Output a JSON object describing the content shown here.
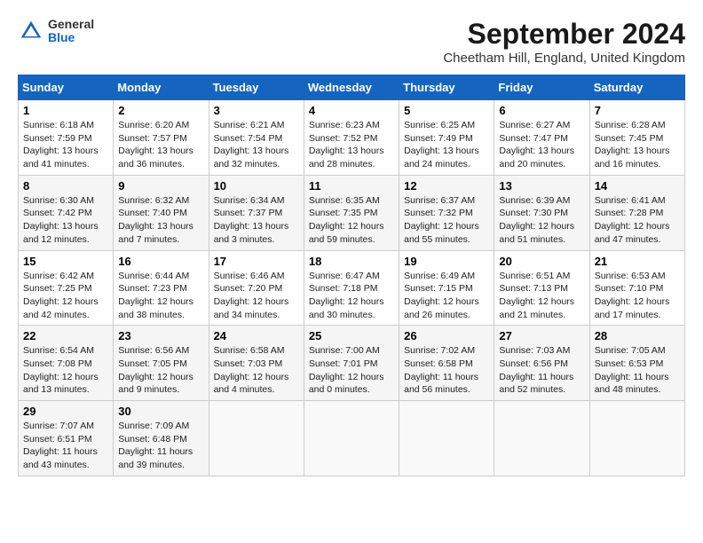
{
  "header": {
    "logo_line1": "General",
    "logo_line2": "Blue",
    "month": "September 2024",
    "location": "Cheetham Hill, England, United Kingdom"
  },
  "days_of_week": [
    "Sunday",
    "Monday",
    "Tuesday",
    "Wednesday",
    "Thursday",
    "Friday",
    "Saturday"
  ],
  "weeks": [
    [
      {
        "day": "1",
        "info": "Sunrise: 6:18 AM\nSunset: 7:59 PM\nDaylight: 13 hours\nand 41 minutes."
      },
      {
        "day": "2",
        "info": "Sunrise: 6:20 AM\nSunset: 7:57 PM\nDaylight: 13 hours\nand 36 minutes."
      },
      {
        "day": "3",
        "info": "Sunrise: 6:21 AM\nSunset: 7:54 PM\nDaylight: 13 hours\nand 32 minutes."
      },
      {
        "day": "4",
        "info": "Sunrise: 6:23 AM\nSunset: 7:52 PM\nDaylight: 13 hours\nand 28 minutes."
      },
      {
        "day": "5",
        "info": "Sunrise: 6:25 AM\nSunset: 7:49 PM\nDaylight: 13 hours\nand 24 minutes."
      },
      {
        "day": "6",
        "info": "Sunrise: 6:27 AM\nSunset: 7:47 PM\nDaylight: 13 hours\nand 20 minutes."
      },
      {
        "day": "7",
        "info": "Sunrise: 6:28 AM\nSunset: 7:45 PM\nDaylight: 13 hours\nand 16 minutes."
      }
    ],
    [
      {
        "day": "8",
        "info": "Sunrise: 6:30 AM\nSunset: 7:42 PM\nDaylight: 13 hours\nand 12 minutes."
      },
      {
        "day": "9",
        "info": "Sunrise: 6:32 AM\nSunset: 7:40 PM\nDaylight: 13 hours\nand 7 minutes."
      },
      {
        "day": "10",
        "info": "Sunrise: 6:34 AM\nSunset: 7:37 PM\nDaylight: 13 hours\nand 3 minutes."
      },
      {
        "day": "11",
        "info": "Sunrise: 6:35 AM\nSunset: 7:35 PM\nDaylight: 12 hours\nand 59 minutes."
      },
      {
        "day": "12",
        "info": "Sunrise: 6:37 AM\nSunset: 7:32 PM\nDaylight: 12 hours\nand 55 minutes."
      },
      {
        "day": "13",
        "info": "Sunrise: 6:39 AM\nSunset: 7:30 PM\nDaylight: 12 hours\nand 51 minutes."
      },
      {
        "day": "14",
        "info": "Sunrise: 6:41 AM\nSunset: 7:28 PM\nDaylight: 12 hours\nand 47 minutes."
      }
    ],
    [
      {
        "day": "15",
        "info": "Sunrise: 6:42 AM\nSunset: 7:25 PM\nDaylight: 12 hours\nand 42 minutes."
      },
      {
        "day": "16",
        "info": "Sunrise: 6:44 AM\nSunset: 7:23 PM\nDaylight: 12 hours\nand 38 minutes."
      },
      {
        "day": "17",
        "info": "Sunrise: 6:46 AM\nSunset: 7:20 PM\nDaylight: 12 hours\nand 34 minutes."
      },
      {
        "day": "18",
        "info": "Sunrise: 6:47 AM\nSunset: 7:18 PM\nDaylight: 12 hours\nand 30 minutes."
      },
      {
        "day": "19",
        "info": "Sunrise: 6:49 AM\nSunset: 7:15 PM\nDaylight: 12 hours\nand 26 minutes."
      },
      {
        "day": "20",
        "info": "Sunrise: 6:51 AM\nSunset: 7:13 PM\nDaylight: 12 hours\nand 21 minutes."
      },
      {
        "day": "21",
        "info": "Sunrise: 6:53 AM\nSunset: 7:10 PM\nDaylight: 12 hours\nand 17 minutes."
      }
    ],
    [
      {
        "day": "22",
        "info": "Sunrise: 6:54 AM\nSunset: 7:08 PM\nDaylight: 12 hours\nand 13 minutes."
      },
      {
        "day": "23",
        "info": "Sunrise: 6:56 AM\nSunset: 7:05 PM\nDaylight: 12 hours\nand 9 minutes."
      },
      {
        "day": "24",
        "info": "Sunrise: 6:58 AM\nSunset: 7:03 PM\nDaylight: 12 hours\nand 4 minutes."
      },
      {
        "day": "25",
        "info": "Sunrise: 7:00 AM\nSunset: 7:01 PM\nDaylight: 12 hours\nand 0 minutes."
      },
      {
        "day": "26",
        "info": "Sunrise: 7:02 AM\nSunset: 6:58 PM\nDaylight: 11 hours\nand 56 minutes."
      },
      {
        "day": "27",
        "info": "Sunrise: 7:03 AM\nSunset: 6:56 PM\nDaylight: 11 hours\nand 52 minutes."
      },
      {
        "day": "28",
        "info": "Sunrise: 7:05 AM\nSunset: 6:53 PM\nDaylight: 11 hours\nand 48 minutes."
      }
    ],
    [
      {
        "day": "29",
        "info": "Sunrise: 7:07 AM\nSunset: 6:51 PM\nDaylight: 11 hours\nand 43 minutes."
      },
      {
        "day": "30",
        "info": "Sunrise: 7:09 AM\nSunset: 6:48 PM\nDaylight: 11 hours\nand 39 minutes."
      },
      {
        "day": "",
        "info": ""
      },
      {
        "day": "",
        "info": ""
      },
      {
        "day": "",
        "info": ""
      },
      {
        "day": "",
        "info": ""
      },
      {
        "day": "",
        "info": ""
      }
    ]
  ]
}
